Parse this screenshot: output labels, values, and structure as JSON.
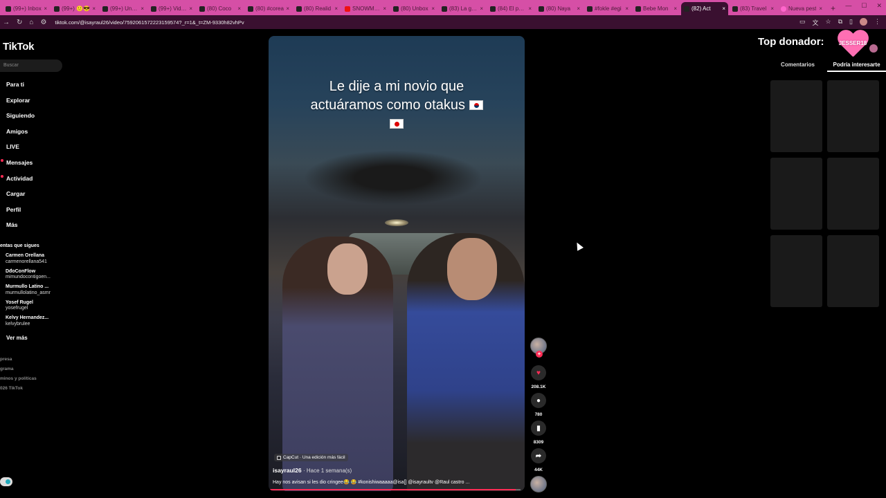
{
  "browser": {
    "tabs": [
      {
        "label": "(99+) Inbox",
        "icon": "tiktok-icon"
      },
      {
        "label": "(99+) 🙂😎",
        "icon": "tiktok-icon"
      },
      {
        "label": "(99+) Unboxing",
        "icon": "tiktok-icon"
      },
      {
        "label": "(99+) Video",
        "icon": "tiktok-icon"
      },
      {
        "label": "(80) Coco",
        "icon": "tiktok-icon"
      },
      {
        "label": "(80) #corea",
        "icon": "tiktok-icon"
      },
      {
        "label": "(80) Realid",
        "icon": "tiktok-icon"
      },
      {
        "label": "SNOWMAN",
        "icon": "youtube-icon"
      },
      {
        "label": "(80) Unbox",
        "icon": "tiktok-icon"
      },
      {
        "label": "(83) La gran",
        "icon": "tiktok-icon"
      },
      {
        "label": "(84) El pero",
        "icon": "tiktok-icon"
      },
      {
        "label": "(80) Naya",
        "icon": "tiktok-icon"
      },
      {
        "label": "#fokle #egi",
        "icon": "tiktok-icon"
      },
      {
        "label": "Bebe Mon",
        "icon": "tiktok-icon"
      },
      {
        "label": "(82) Act",
        "icon": "tiktok-icon",
        "active": true
      },
      {
        "label": "(83) Travel",
        "icon": "tiktok-icon"
      },
      {
        "label": "Nueva pest",
        "icon": "pink-icon"
      }
    ],
    "new_tab": "+",
    "url": "tiktok.com/@isayraul26/video/7592061572223159574?_r=1&_t=ZM-9330h82vhPv"
  },
  "sidebar": {
    "logo": "TikTok",
    "search_placeholder": "Buscar",
    "nav": [
      {
        "label": "Para ti",
        "icon": "home-icon"
      },
      {
        "label": "Explorar",
        "icon": "compass-icon"
      },
      {
        "label": "Siguiendo",
        "icon": "following-icon"
      },
      {
        "label": "Amigos",
        "icon": "friends-icon"
      },
      {
        "label": "LIVE",
        "icon": "live-icon"
      },
      {
        "label": "Mensajes",
        "icon": "messages-icon"
      },
      {
        "label": "Actividad",
        "icon": "activity-icon"
      },
      {
        "label": "Cargar",
        "icon": "upload-icon"
      },
      {
        "label": "Perfil",
        "icon": "profile-icon"
      },
      {
        "label": "Más",
        "icon": "more-icon"
      }
    ],
    "following_header": "entas que sigues",
    "accounts": [
      {
        "name": "Carmen Orellana",
        "user": "carmenorellana541"
      },
      {
        "name": "DđoConFlow",
        "user": "mimundocontigoen..."
      },
      {
        "name": "Murmullo Latino ...",
        "user": "murmullolatino_asmr"
      },
      {
        "name": "Yosef Rugel",
        "user": "yosefrugel"
      },
      {
        "name": "Kelvy Hernandez...",
        "user": "kelvybrulee"
      }
    ],
    "see_more": "Ver más",
    "footer": [
      "presa",
      "grama",
      "minos y políticas",
      "026 TikTok"
    ]
  },
  "video": {
    "caption_line1": "Le dije a mi novio que",
    "caption_line2": "actuáramos como otakus",
    "capcut": "CapCut · Una edición más fácil",
    "author": "isayraul26",
    "time": "· Hace 1 semana(s)",
    "description": "Hay nos avisan si les dio cringee😂 😂 #konishiwaaaaa@isa[] @isayraultv @Raul castro ...",
    "progress": 0.98
  },
  "actions": {
    "likes": "208.1K",
    "comments": "780",
    "saves": "8309",
    "shares": "44K"
  },
  "right_panel": {
    "top_donor_label": "Top donador:",
    "donor_name": "JESSER18",
    "tabs": [
      "Comentarios",
      "Podría interesarte"
    ],
    "active_tab": 1
  },
  "colors": {
    "accent": "#fe2c55",
    "tabbar": "#d64fa6",
    "addressbar": "#3a1030"
  }
}
